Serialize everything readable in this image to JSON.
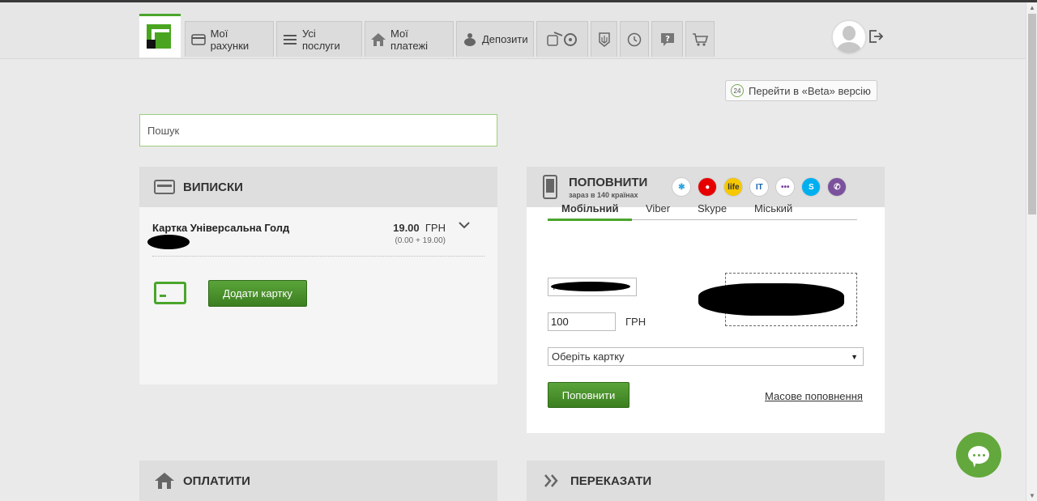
{
  "nav": {
    "tabs": [
      {
        "icon": "credit-card-icon",
        "label": "Мої рахунки"
      },
      {
        "icon": "list-icon",
        "label": "Усі послуги"
      },
      {
        "icon": "house-icon",
        "label": "Мої платежі"
      },
      {
        "icon": "piggy-bank-icon",
        "label": "Депозити"
      }
    ],
    "icon_tabs": [
      "transport-icon",
      "coat-of-arms-icon",
      "history-icon",
      "help-icon",
      "cart-icon"
    ]
  },
  "beta": {
    "badge": "24",
    "label": "Перейти в «Beta» версію"
  },
  "search": {
    "placeholder": "Пошук"
  },
  "statements": {
    "title": "ВИПИСКИ",
    "card_name": "Картка Універсальна Голд",
    "amount_value": "19.00",
    "amount_currency": "ГРН",
    "amount_breakdown": "(0.00 + 19.00)",
    "add_card_label": "Додати картку"
  },
  "topup": {
    "title": "ПОПОВНИТИ",
    "subtitle": "зараз в 140 країнах",
    "operators": [
      {
        "icon": "kyivstar-icon",
        "color": "#ffffff",
        "text": "✱",
        "fg": "#2da5e0"
      },
      {
        "icon": "vodafone-icon",
        "color": "#e60000",
        "text": "●",
        "fg": "#ffffff"
      },
      {
        "icon": "lifecell-icon",
        "color": "#f6c800",
        "text": "life",
        "fg": "#333333"
      },
      {
        "icon": "intertelecom-icon",
        "color": "#ffffff",
        "text": "IT",
        "fg": "#1a66b0"
      },
      {
        "icon": "trimob-icon",
        "color": "#ffffff",
        "text": "•••",
        "fg": "#7b3fa0"
      },
      {
        "icon": "skype-icon",
        "color": "#00aff0",
        "text": "S",
        "fg": "#ffffff"
      },
      {
        "icon": "viber-icon",
        "color": "#7b519d",
        "text": "✆",
        "fg": "#ffffff"
      }
    ],
    "tabs": [
      "Мобільний",
      "Viber",
      "Skype",
      "Міський"
    ],
    "phone_prefix": "+",
    "amount_value": "100",
    "currency": "ГРН",
    "card_select": "Оберіть картку",
    "submit_label": "Поповнити",
    "mass_topup_link": "Масове поповнення"
  },
  "pay": {
    "title": "ОПЛАТИТИ"
  },
  "transfer": {
    "title": "ПЕРЕКАЗАТИ"
  }
}
